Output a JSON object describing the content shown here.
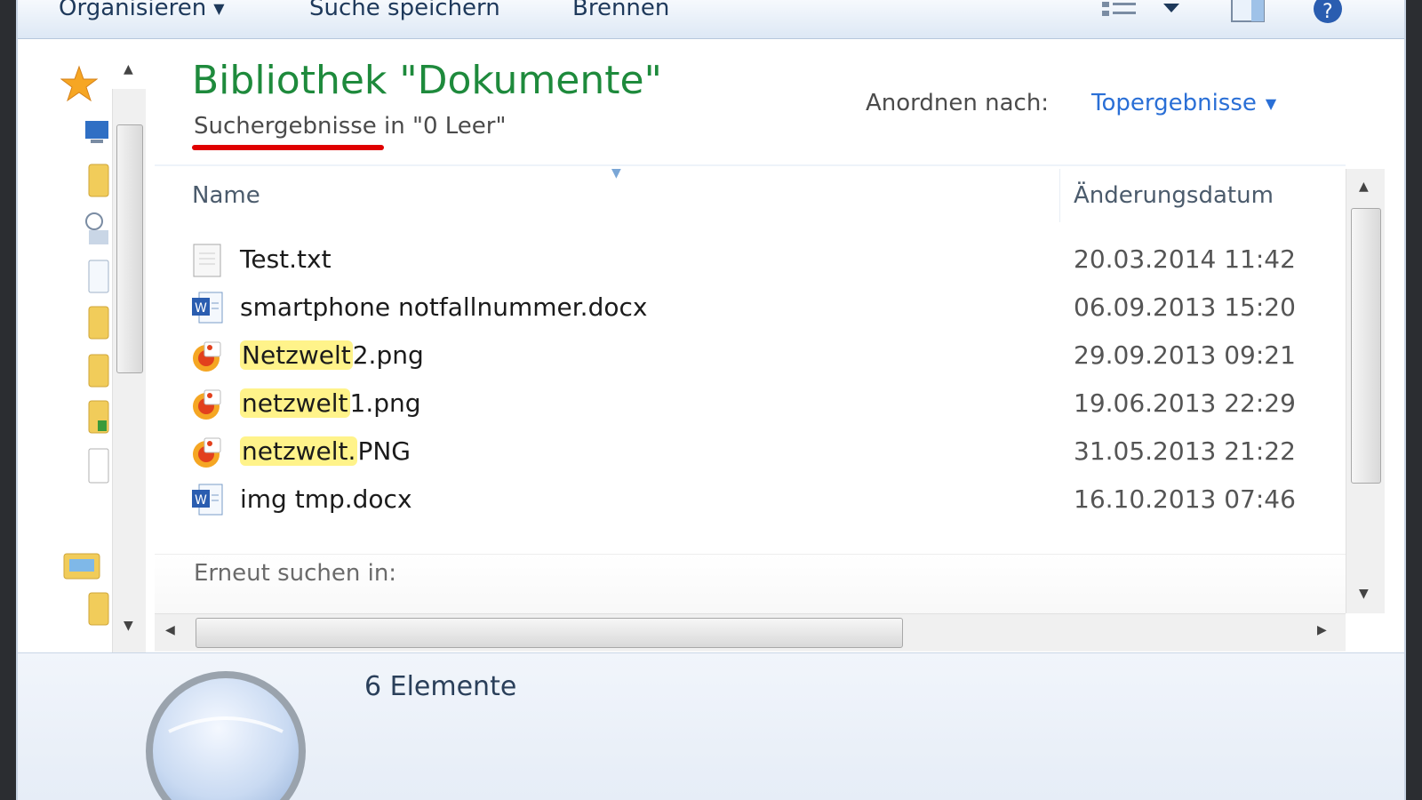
{
  "toolbar": {
    "organize": "Organisieren",
    "save_search": "Suche speichern",
    "burn": "Brennen",
    "icons": [
      "view-options-icon",
      "chevron-down-icon",
      "preview-pane-icon",
      "help-icon"
    ]
  },
  "navigation": {
    "icons": [
      "favorites-star-icon",
      "desktop-icon",
      "folder-icon",
      "recent-places-icon",
      "document-icon",
      "folder-icon",
      "folder-icon",
      "folder-icon",
      "blank-page-icon",
      "libraries-icon",
      "folder-icon"
    ]
  },
  "library": {
    "title": "Bibliothek \"Dokumente\"",
    "subtitle_term": "Suchergebnisse",
    "subtitle_rest": " in \"0 Leer\"",
    "arrange_label": "Anordnen nach:",
    "arrange_value": "Topergebnisse"
  },
  "columns": {
    "name": "Name",
    "date": "Änderungsdatum"
  },
  "files": [
    {
      "name_pre": "",
      "name_hl": "",
      "name_post": "Test.txt",
      "date": "20.03.2014 11:42",
      "icon": "text-file-icon"
    },
    {
      "name_pre": "",
      "name_hl": "",
      "name_post": "smartphone notfallnummer.docx",
      "date": "06.09.2013 15:20",
      "icon": "word-document-icon"
    },
    {
      "name_pre": "",
      "name_hl": "Netzwelt",
      "name_post": "2.png",
      "date": "29.09.2013 09:21",
      "icon": "image-file-icon"
    },
    {
      "name_pre": "",
      "name_hl": "netzwelt",
      "name_post": "1.png",
      "date": "19.06.2013 22:29",
      "icon": "image-file-icon"
    },
    {
      "name_pre": "",
      "name_hl": "netzwelt.",
      "name_post": "PNG",
      "date": "31.05.2013 21:22",
      "icon": "image-file-icon"
    },
    {
      "name_pre": "",
      "name_hl": "",
      "name_post": "img tmp.docx",
      "date": "16.10.2013 07:46",
      "icon": "word-document-icon"
    }
  ],
  "search_again": {
    "label": "Erneut suchen in:"
  },
  "details": {
    "count": "6 Elemente"
  },
  "colors": {
    "title_green": "#1e8a3c",
    "link_blue": "#2a6fd6",
    "highlight_yellow": "#fff38a",
    "annotation_red": "#e00000"
  }
}
